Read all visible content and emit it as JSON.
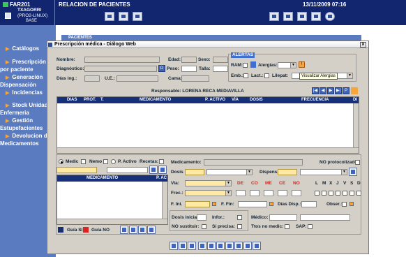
{
  "app": {
    "code": "FAR201",
    "window_title": "RELACION DE PACIENTES",
    "datetime": "13/11/2009 07:16",
    "user": "TXAGORRI",
    "system": "(PRO2-LINUX)",
    "extra": "BASE"
  },
  "sidebar": {
    "items": [
      {
        "label": "Catálogos"
      },
      {
        "label": "Prescripción",
        "label2": "por paciente"
      },
      {
        "label": "Generación",
        "label2": "Dispensación"
      },
      {
        "label": "Incidencias"
      },
      {
        "label": "Stock Unidad",
        "label2": "Enfermeria"
      },
      {
        "label": "Gestión",
        "label2": "Estupefacientes"
      },
      {
        "label": "Devolucion de",
        "label2": "Medicamentos"
      }
    ]
  },
  "bg_tab": "PACIENTES",
  "dialog": {
    "title": "Prescripción médica - Diálogo Web",
    "close": "x",
    "labels": {
      "nombre": "Nombre:",
      "edad": "Edad:",
      "sexo": "Sexo:",
      "diagnostico": "Diagnóstico:",
      "d": "D",
      "peso": "Peso:",
      "talla": "Talla:",
      "dias_ing": "Días ing.:",
      "ue": "U.E.:",
      "cama": "Cama:"
    },
    "alertas": {
      "title": "ALERTAS",
      "ram": "RAM:",
      "alergias": "Alergias:",
      "emb": "Emb.:",
      "lact": "Lact.:",
      "lilepat": "Lilepat:",
      "tooltip": "Visualizar Alergias"
    },
    "responsable": "Responsable: LORENA RECA MEDIAVILLA",
    "table": {
      "columns": [
        "DIAS",
        "PROT.",
        "T.",
        "MEDICAMENTO",
        "P. ACTIVO",
        "VÍA",
        "DOSIS",
        "FRECUENCIA",
        "DI"
      ]
    },
    "search": {
      "medic": "Medic",
      "nemo": "Nemo",
      "pactivo": "P. Activo",
      "recetas": "Recetas:",
      "col_med": "MEDICAMENTO",
      "col_pa": "P. AC",
      "guia_si": "Guía SI",
      "guia_no": "Guía NO"
    },
    "detail": {
      "medicamento": "Medicamento:",
      "no_protocolizado": "NO protocolizado:",
      "dosis": "Dosis",
      "dispens": "Dispens.",
      "via": "Vía:",
      "de": "DE",
      "co": "CO",
      "me": "ME",
      "ce": "CE",
      "no": "NO",
      "days": [
        "L",
        "M",
        "X",
        "J",
        "V",
        "S",
        "D"
      ],
      "frec": "Frec.:",
      "f_ini": "F. Ini.",
      "f_fin": "F. Fin:",
      "dias_disp": "Días Disp.:",
      "obser": "Obser.:",
      "dosis_inicial": "Dosis inicial:",
      "infor": "Infor.:",
      "medico": "Médico:",
      "no_sustituir": "NO sustituir:",
      "si_precisa": "Si precisa:",
      "ttos": "Ttos no medic:",
      "sap": "SAP:"
    }
  }
}
